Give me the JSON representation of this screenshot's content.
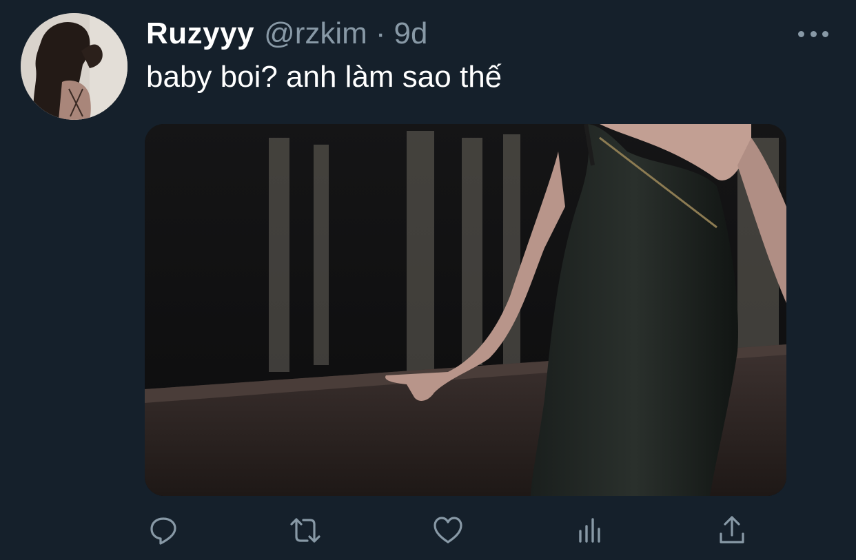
{
  "tweet": {
    "display_name": "Ruzyyy",
    "handle": "@rzkim",
    "separator": "·",
    "time": "9d",
    "text": "baby boi? anh làm sao thế"
  },
  "icons": {
    "more": "more-horizontal-icon",
    "reply": "reply-icon",
    "retweet": "retweet-icon",
    "like": "heart-icon",
    "analytics": "analytics-icon",
    "share": "share-icon"
  },
  "colors": {
    "background": "#15202b",
    "primary_text": "#ffffff",
    "secondary_text": "#8899a6"
  }
}
